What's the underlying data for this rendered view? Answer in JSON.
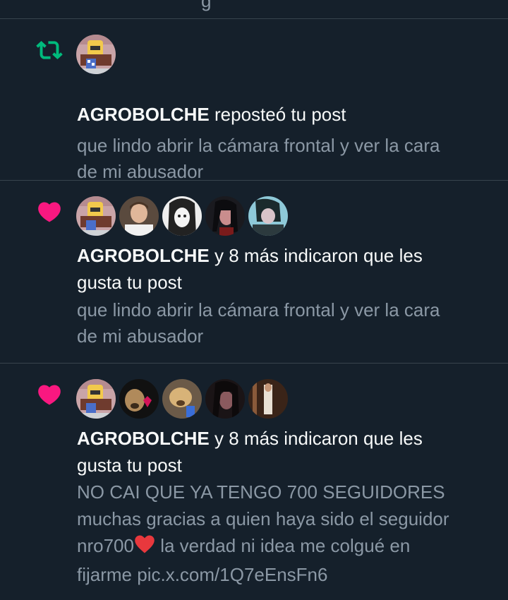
{
  "top": {
    "partial_char": "g"
  },
  "notifications": [
    {
      "type": "repost",
      "icon": "repost-icon",
      "user": "AGROBOLCHE",
      "action": " reposteó tu post",
      "preview_lines": [
        "que lindo abrir la cámara frontal y ver la cara",
        "de mi abusador"
      ]
    },
    {
      "type": "like",
      "icon": "heart-icon",
      "user": "AGROBOLCHE",
      "action_line1": " y 8 más indicaron que les",
      "action_line2": "gusta tu post",
      "preview_lines": [
        "que lindo abrir la cámara frontal y ver la cara",
        "de mi abusador"
      ]
    },
    {
      "type": "like",
      "icon": "heart-icon",
      "user": "AGROBOLCHE",
      "action_line1": " y 8 más indicaron que les",
      "action_line2": "gusta tu post",
      "preview_lines": [
        "NO CAI QUE YA TENGO 700 SEGUIDORES",
        "muchas gracias a quien haya sido el seguidor",
        "nro700",
        " la verdad ni idea me colgué en",
        "fijarme pic.x.com/1Q7eEnsFn6"
      ]
    }
  ],
  "colors": {
    "background": "#15202b",
    "divider": "#38444d",
    "repost": "#00ba7c",
    "like": "#f91880",
    "secondary_text": "#8b98a5"
  }
}
